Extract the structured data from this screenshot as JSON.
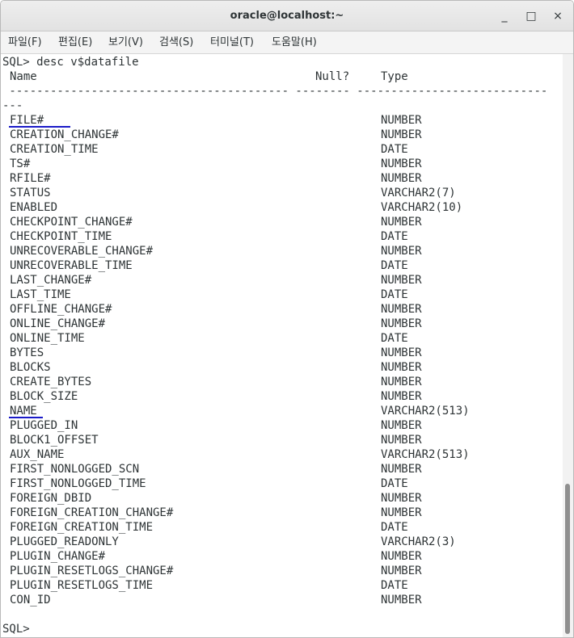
{
  "window": {
    "title": "oracle@localhost:~",
    "minimize_label": "_",
    "maximize_label": "□",
    "close_label": "×"
  },
  "menu": [
    "파일(F)",
    "편집(E)",
    "보기(V)",
    "검색(S)",
    "터미널(T)",
    "도움말(H)"
  ],
  "terminal": {
    "command": "SQL> desc v$datafile",
    "header": {
      "name": "Name",
      "null": "Null?",
      "type": "Type"
    },
    "separator": " ----------------------------------------- -------- ----------------------------",
    "separator_wrap": "---",
    "rows": [
      {
        "name": "FILE#",
        "type": "NUMBER"
      },
      {
        "name": "CREATION_CHANGE#",
        "type": "NUMBER"
      },
      {
        "name": "CREATION_TIME",
        "type": "DATE"
      },
      {
        "name": "TS#",
        "type": "NUMBER"
      },
      {
        "name": "RFILE#",
        "type": "NUMBER"
      },
      {
        "name": "STATUS",
        "type": "VARCHAR2(7)"
      },
      {
        "name": "ENABLED",
        "type": "VARCHAR2(10)"
      },
      {
        "name": "CHECKPOINT_CHANGE#",
        "type": "NUMBER"
      },
      {
        "name": "CHECKPOINT_TIME",
        "type": "DATE"
      },
      {
        "name": "UNRECOVERABLE_CHANGE#",
        "type": "NUMBER"
      },
      {
        "name": "UNRECOVERABLE_TIME",
        "type": "DATE"
      },
      {
        "name": "LAST_CHANGE#",
        "type": "NUMBER"
      },
      {
        "name": "LAST_TIME",
        "type": "DATE"
      },
      {
        "name": "OFFLINE_CHANGE#",
        "type": "NUMBER"
      },
      {
        "name": "ONLINE_CHANGE#",
        "type": "NUMBER"
      },
      {
        "name": "ONLINE_TIME",
        "type": "DATE"
      },
      {
        "name": "BYTES",
        "type": "NUMBER"
      },
      {
        "name": "BLOCKS",
        "type": "NUMBER"
      },
      {
        "name": "CREATE_BYTES",
        "type": "NUMBER"
      },
      {
        "name": "BLOCK_SIZE",
        "type": "NUMBER"
      },
      {
        "name": "NAME",
        "type": "VARCHAR2(513)"
      },
      {
        "name": "PLUGGED_IN",
        "type": "NUMBER"
      },
      {
        "name": "BLOCK1_OFFSET",
        "type": "NUMBER"
      },
      {
        "name": "AUX_NAME",
        "type": "VARCHAR2(513)"
      },
      {
        "name": "FIRST_NONLOGGED_SCN",
        "type": "NUMBER"
      },
      {
        "name": "FIRST_NONLOGGED_TIME",
        "type": "DATE"
      },
      {
        "name": "FOREIGN_DBID",
        "type": "NUMBER"
      },
      {
        "name": "FOREIGN_CREATION_CHANGE#",
        "type": "NUMBER"
      },
      {
        "name": "FOREIGN_CREATION_TIME",
        "type": "DATE"
      },
      {
        "name": "PLUGGED_READONLY",
        "type": "VARCHAR2(3)"
      },
      {
        "name": "PLUGIN_CHANGE#",
        "type": "NUMBER"
      },
      {
        "name": "PLUGIN_RESETLOGS_CHANGE#",
        "type": "NUMBER"
      },
      {
        "name": "PLUGIN_RESETLOGS_TIME",
        "type": "DATE"
      },
      {
        "name": "CON_ID",
        "type": "NUMBER"
      }
    ],
    "prompt": "SQL>"
  },
  "colors": {
    "underline": "#1a1ac8",
    "text": "#2e3436"
  }
}
